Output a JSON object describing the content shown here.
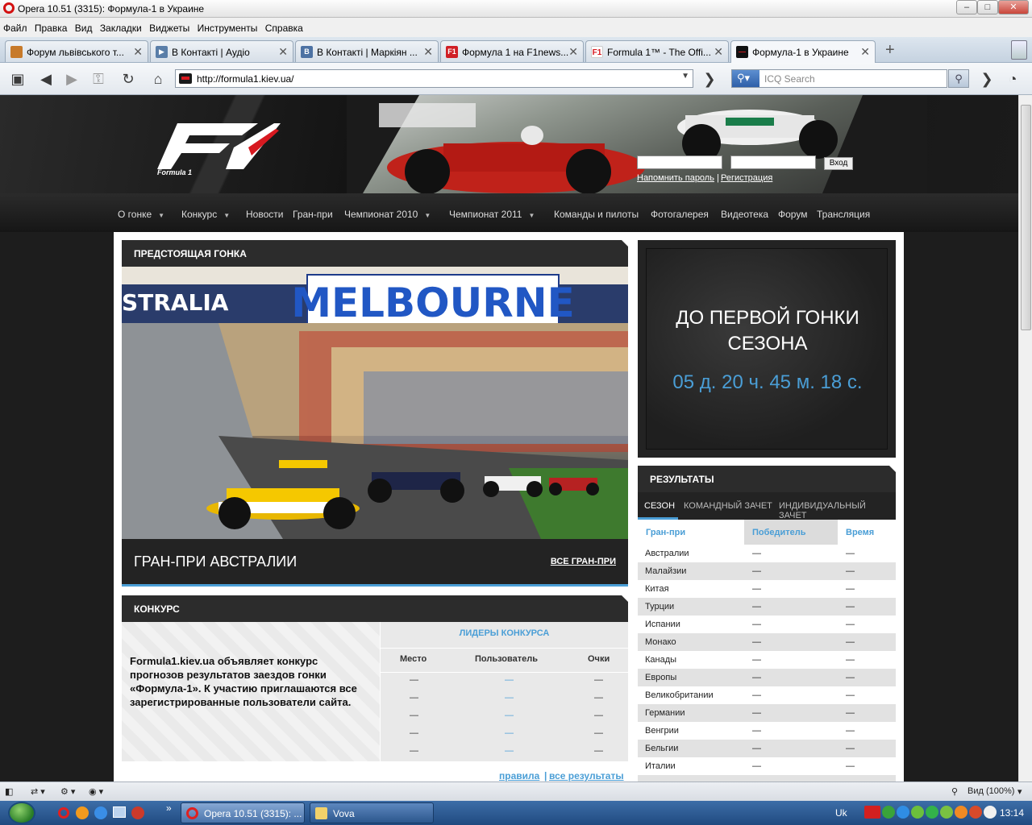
{
  "window": {
    "title": "Opera 10.51 (3315): Формула-1 в Украине",
    "minimize": "–",
    "maximize": "□",
    "close": "✕"
  },
  "menu": [
    "Файл",
    "Правка",
    "Вид",
    "Закладки",
    "Виджеты",
    "Инструменты",
    "Справка"
  ],
  "tabs": [
    {
      "label": "Форум львівського т...",
      "icon_color": "#c77a2a",
      "icon_text": ""
    },
    {
      "label": "В Контакті | Аудіо",
      "icon_color": "#5a7ea8",
      "icon_text": "▶"
    },
    {
      "label": "В Контакті | Маркіян ...",
      "icon_color": "#4d72a3",
      "icon_text": "B"
    },
    {
      "label": "Формула 1 на F1news...",
      "icon_color": "#d01f25",
      "icon_text": "F1"
    },
    {
      "label": "Formula 1™ - The Offi...",
      "icon_color": "#ffffff",
      "icon_text": ""
    },
    {
      "label": "Формула-1 в Украине",
      "icon_color": "#111111",
      "icon_text": ""
    }
  ],
  "tab_close_glyph": "✕",
  "new_tab_glyph": "+",
  "address": {
    "url": "http://formula1.kiev.ua/",
    "search_placeholder": "ICQ Search"
  },
  "site": {
    "logo_text": "Formula 1",
    "login_button": "Вход",
    "forgot_password": "Напомнить пароль",
    "separator": "|",
    "register": "Регистрация",
    "nav": [
      {
        "label": "О гонке",
        "dropdown": true
      },
      {
        "label": "Конкурс",
        "dropdown": true
      },
      {
        "label": "Новости",
        "dropdown": false
      },
      {
        "label": "Гран-при",
        "dropdown": false
      },
      {
        "label": "Чемпионат 2010",
        "dropdown": true
      },
      {
        "label": "Чемпионат 2011",
        "dropdown": true
      },
      {
        "label": "Команды и пилоты",
        "dropdown": false
      },
      {
        "label": "Фотогалерея",
        "dropdown": false
      },
      {
        "label": "Видеотека",
        "dropdown": false
      },
      {
        "label": "Форум",
        "dropdown": false
      },
      {
        "label": "Трансляция",
        "dropdown": false
      }
    ],
    "upcoming": {
      "title": "ПРЕДСТОЯЩАЯ ГОНКА",
      "photo_banner_left": "STRALIA",
      "photo_banner_main": "MELBOURNE",
      "race_name": "ГРАН-ПРИ АВСТРАЛИИ",
      "all_gp": "ВСЕ ГРАН-ПРИ"
    },
    "contest": {
      "title": "КОНКУРС",
      "text": "Formula1.kiev.ua объявляет конкурс прогнозов результатов заездов гонки «Формула-1». К участию приглашаются все зарегистрированные пользователи сайта.",
      "leaders_title": "ЛИДЕРЫ КОНКУРСА",
      "columns": [
        "Место",
        "Пользователь",
        "Очки"
      ],
      "rows": [
        [
          "—",
          "—",
          "—"
        ],
        [
          "—",
          "—",
          "—"
        ],
        [
          "—",
          "—",
          "—"
        ],
        [
          "—",
          "—",
          "—"
        ],
        [
          "—",
          "—",
          "—"
        ]
      ],
      "rules": "правила",
      "separator": "|",
      "all_results": "все результаты"
    },
    "countdown": {
      "title_line1": "ДО ПЕРВОЙ ГОНКИ",
      "title_line2": "СЕЗОНА",
      "time": "05 д. 20 ч. 45 м. 18 с."
    },
    "results": {
      "title": "РЕЗУЛЬТАТЫ",
      "tabs": [
        "СЕЗОН",
        "КОМАНДНЫЙ ЗАЧЕТ",
        "ИНДИВИДУАЛЬНЫЙ ЗАЧЕТ"
      ],
      "columns": [
        "Гран-при",
        "Победитель",
        "Время"
      ],
      "rows": [
        [
          "Австралии",
          "—",
          "—"
        ],
        [
          "Малайзии",
          "—",
          "—"
        ],
        [
          "Китая",
          "—",
          "—"
        ],
        [
          "Турции",
          "—",
          "—"
        ],
        [
          "Испании",
          "—",
          "—"
        ],
        [
          "Монако",
          "—",
          "—"
        ],
        [
          "Канады",
          "—",
          "—"
        ],
        [
          "Европы",
          "—",
          "—"
        ],
        [
          "Великобритании",
          "—",
          "—"
        ],
        [
          "Германии",
          "—",
          "—"
        ],
        [
          "Венгрии",
          "—",
          "—"
        ],
        [
          "Бельгии",
          "—",
          "—"
        ],
        [
          "Италии",
          "—",
          "—"
        ]
      ]
    }
  },
  "statusbar": {
    "zoom": "Вид (100%)"
  },
  "taskbar": {
    "tasks": [
      {
        "label": "Opera 10.51 (3315): ...",
        "active": true
      },
      {
        "label": "Vova",
        "active": false
      }
    ],
    "lang": "Uk",
    "clock": "13:14",
    "chevron": "»"
  },
  "colors": {
    "accent": "#4a9ed6",
    "site_dark": "#232323",
    "f1_red": "#d71920"
  }
}
